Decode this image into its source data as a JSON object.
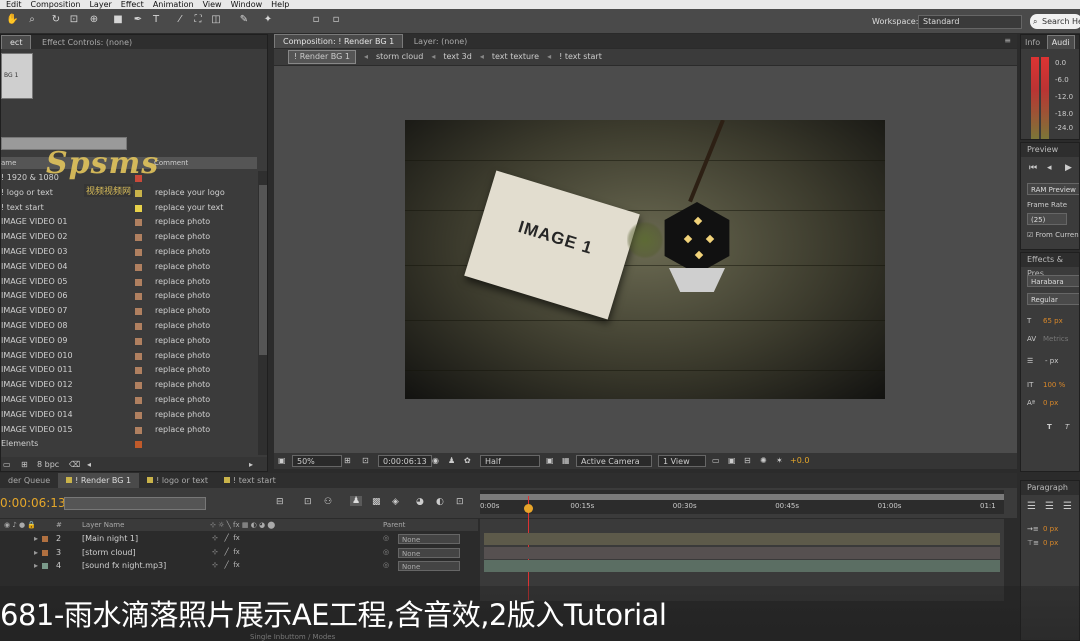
{
  "menu": [
    "Edit",
    "Composition",
    "Layer",
    "Effect",
    "Animation",
    "View",
    "Window",
    "Help"
  ],
  "toolbar": {
    "workspace_label": "Workspace:",
    "workspace_value": "Standard",
    "search_placeholder": "Search He"
  },
  "project_panel": {
    "tabs": [
      "ect",
      "Effect Controls: (none)"
    ],
    "thumb_text": "BG 1",
    "header": {
      "name": "ame",
      "comment": "Comment"
    },
    "items": [
      {
        "name": "! 1920 & 1080",
        "comment": "",
        "label_color": "#c94a3a"
      },
      {
        "name": "! logo or text",
        "comment": "replace your logo",
        "label_color": "#c9b34a"
      },
      {
        "name": "! text start",
        "comment": "replace your text",
        "label_color": "#e8d24a"
      },
      {
        "name": "IMAGE VIDEO 01",
        "comment": "replace photo",
        "label_color": "#b08060"
      },
      {
        "name": "IMAGE VIDEO 02",
        "comment": "replace photo",
        "label_color": "#b08060"
      },
      {
        "name": "IMAGE VIDEO 03",
        "comment": "replace photo",
        "label_color": "#b08060"
      },
      {
        "name": "IMAGE VIDEO 04",
        "comment": "replace photo",
        "label_color": "#b08060"
      },
      {
        "name": "IMAGE VIDEO 05",
        "comment": "replace photo",
        "label_color": "#b08060"
      },
      {
        "name": "IMAGE VIDEO 06",
        "comment": "replace photo",
        "label_color": "#b08060"
      },
      {
        "name": "IMAGE VIDEO 07",
        "comment": "replace photo",
        "label_color": "#b08060"
      },
      {
        "name": "IMAGE VIDEO 08",
        "comment": "replace photo",
        "label_color": "#b08060"
      },
      {
        "name": "IMAGE VIDEO 09",
        "comment": "replace photo",
        "label_color": "#b08060"
      },
      {
        "name": "IMAGE VIDEO 010",
        "comment": "replace photo",
        "label_color": "#b08060"
      },
      {
        "name": "IMAGE VIDEO 011",
        "comment": "replace photo",
        "label_color": "#b08060"
      },
      {
        "name": "IMAGE VIDEO 012",
        "comment": "replace photo",
        "label_color": "#b08060"
      },
      {
        "name": "IMAGE VIDEO 013",
        "comment": "replace photo",
        "label_color": "#b08060"
      },
      {
        "name": "IMAGE VIDEO 014",
        "comment": "replace photo",
        "label_color": "#b08060"
      },
      {
        "name": "IMAGE VIDEO 015",
        "comment": "replace photo",
        "label_color": "#b08060"
      },
      {
        "name": "Elements",
        "comment": "",
        "label_color": "#c05a2a"
      }
    ],
    "footer_bpc": "8 bpc"
  },
  "watermark": {
    "text": "Spsms",
    "sub": "视频视频网"
  },
  "composition": {
    "tabs": [
      "Composition: ! Render BG 1",
      "Layer: (none)"
    ],
    "breadcrumbs": [
      "! Render BG 1",
      "storm cloud",
      "text 3d",
      "text texture",
      "! text start"
    ],
    "image_label": "IMAGE 1",
    "footer": {
      "zoom": "50%",
      "timecode": "0:00:06:13",
      "resolution": "Half",
      "camera": "Active Camera",
      "views": "1 View",
      "exposure": "+0.0"
    }
  },
  "right_panel": {
    "info_tabs": [
      "Info",
      "Audi"
    ],
    "meter_labels": [
      "0.0",
      "-6.0",
      "-12.0",
      "-18.0",
      "-24.0"
    ],
    "preview_title": "Preview",
    "ram_preview": "RAM Preview",
    "frame_rate_label": "Frame Rate",
    "frame_rate_value": "(25)",
    "from_current": "From Curren",
    "effects_title": "Effects & Pres",
    "font_name": "Harabara",
    "font_style": "Regular",
    "font_size": "65 px",
    "tracking_label": "Metrics",
    "leading": "- px",
    "scale": "100 %",
    "baseline": "0 px",
    "paragraph_title": "Paragraph",
    "para_values": [
      "0 px",
      "0 px"
    ]
  },
  "timeline": {
    "tabs": [
      "der Queue",
      "! Render BG 1",
      "! logo or text",
      "! text start"
    ],
    "timecode": "0:00:06:13",
    "ruler_ticks": [
      "0:00s",
      "00:15s",
      "00:30s",
      "00:45s",
      "01:00s",
      "01:1"
    ],
    "header": {
      "num": "#",
      "layer_name": "Layer Name",
      "parent": "Parent"
    },
    "layers": [
      {
        "num": "2",
        "name": "[Main night 1]",
        "parent": "None",
        "color": "#b07040",
        "track_color": "#5d5a4a"
      },
      {
        "num": "3",
        "name": "[storm cloud]",
        "parent": "None",
        "color": "#b07040",
        "track_color": "#565050"
      },
      {
        "num": "4",
        "name": "[sound fx night.mp3]",
        "parent": "None",
        "color": "#7a9a8a",
        "track_color": "#5b6e63"
      }
    ]
  },
  "subtitle": "681-雨水滴落照片展示AE工程,含音效,2版入Tutorial",
  "bottom_hint": "Single Inbuttom / Modes"
}
